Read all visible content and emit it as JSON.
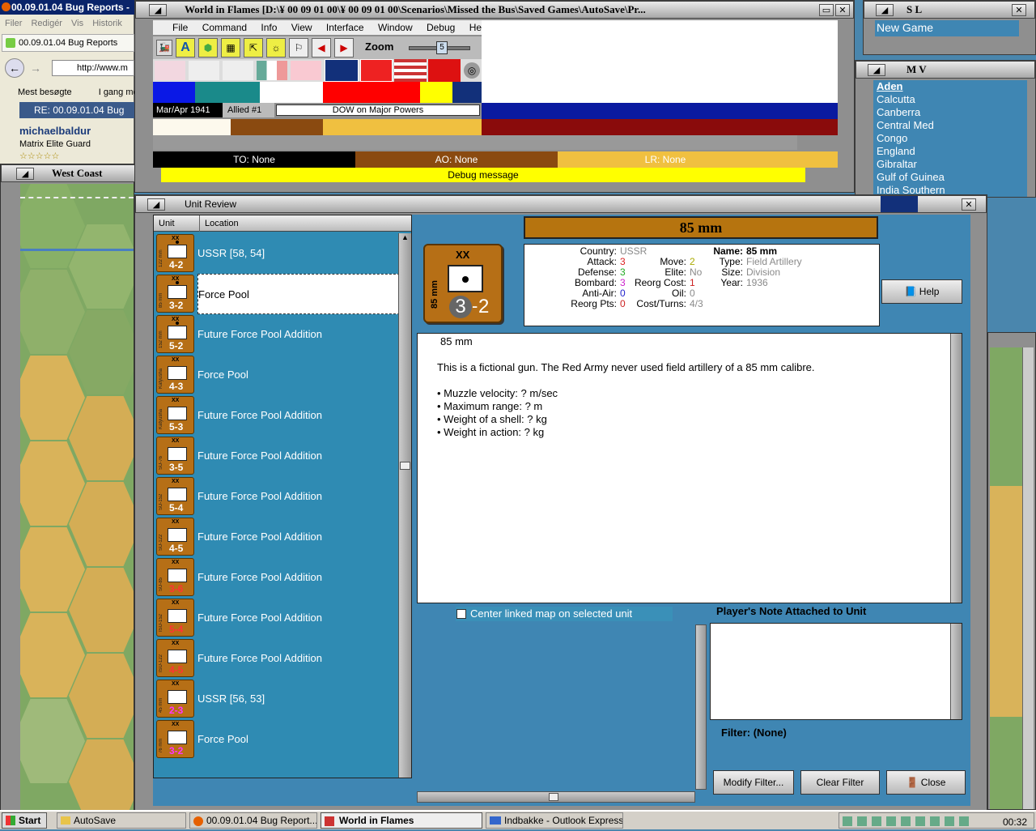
{
  "browser": {
    "title": "00.09.01.04 Bug Reports -",
    "menu": [
      "Filer",
      "Redigér",
      "Vis",
      "Historik"
    ],
    "tab": "00.09.01.04 Bug Reports",
    "url": "http://www.m",
    "bookmarks": [
      "Mest besøgte",
      "I gang me"
    ],
    "post_title": "RE: 00.09.01.04 Bug",
    "user": "michaelbaldur",
    "user_rank": "Matrix Elite Guard",
    "stars": "☆☆☆☆☆"
  },
  "westcoast": {
    "title": "West Coast"
  },
  "main": {
    "title": "World in Flames [D:\\¥ 00 09 01 00\\¥ 00 09 01 00\\Scenarios\\Missed the Bus\\Saved Games\\AutoSave\\Pr...",
    "menu": [
      "File",
      "Command",
      "Info",
      "View",
      "Interface",
      "Window",
      "Debug",
      "Help"
    ],
    "zoom_label": "Zoom",
    "zoom_value": "5",
    "date": "Mar/Apr 1941",
    "allied": "Allied #1",
    "dow": "DOW on Major Powers",
    "to": "TO: None",
    "ao": "AO: None",
    "lr": "LR: None",
    "debug": "Debug message"
  },
  "sl": {
    "title": "S L",
    "value": "New Game"
  },
  "mv": {
    "title": "M V",
    "items": [
      "Aden",
      "Calcutta",
      "Canberra",
      "Central Med",
      "Congo",
      "England",
      "Gibraltar",
      "Gulf of Guinea",
      "India Southern"
    ]
  },
  "review": {
    "title": "Unit Review",
    "col_unit": "Unit",
    "col_location": "Location",
    "rows": [
      {
        "side": "122 mm",
        "str": "4-2",
        "loc": "USSR [58, 54]"
      },
      {
        "side": "85 mm",
        "str": "3-2",
        "loc": "Force Pool"
      },
      {
        "side": "152 mm",
        "str": "5-2",
        "loc": "Future Force Pool Addition"
      },
      {
        "side": "Katyusha",
        "str": "4-3",
        "loc": "Force Pool"
      },
      {
        "side": "Katyusha",
        "str": "5-3",
        "loc": "Future Force Pool Addition"
      },
      {
        "side": "SU-76",
        "str": "3-5",
        "loc": "Future Force Pool Addition"
      },
      {
        "side": "SU-152",
        "str": "5-4",
        "loc": "Future Force Pool Addition"
      },
      {
        "side": "SU-122",
        "str": "4-5",
        "loc": "Future Force Pool Addition"
      },
      {
        "side": "SU-85",
        "str": "3-6",
        "loc": "Future Force Pool Addition"
      },
      {
        "side": "ISU-152",
        "str": "5-4",
        "loc": "Future Force Pool Addition"
      },
      {
        "side": "ISU-122",
        "str": "4-5",
        "loc": "Future Force Pool Addition"
      },
      {
        "side": "45 mm",
        "str": "2-3",
        "loc": "USSR [56, 53]"
      },
      {
        "side": "76 mm",
        "str": "3-2",
        "loc": "Force Pool"
      }
    ],
    "unit_name": "85 mm",
    "counter_xx": "XX",
    "counter_side": "85 mm",
    "counter_att": "3",
    "counter_sep": "-",
    "counter_mov": "2",
    "country_l": "Country:",
    "country": "USSR",
    "attack_l": "Attack:",
    "attack": "3",
    "defense_l": "Defense:",
    "defense": "3",
    "bombard_l": "Bombard:",
    "bombard": "3",
    "aa_l": "Anti-Air:",
    "aa": "0",
    "rp_l": "Reorg Pts:",
    "rp": "0",
    "move_l": "Move:",
    "move": "2",
    "elite_l": "Elite:",
    "elite": "No",
    "rc_l": "Reorg Cost:",
    "rc": "1",
    "oil_l": "Oil:",
    "oil": "0",
    "ct_l": "Cost/Turns:",
    "ct": "4/3",
    "name_l": "Name:",
    "name": "85 mm",
    "type_l": "Type:",
    "type": "Field Artillery",
    "size_l": "Size:",
    "size": "Division",
    "year_l": "Year:",
    "year": "1936",
    "help": "Help",
    "desc_title": "85 mm",
    "desc_body": "This is a fictional gun.  The Red Army never used field artillery of a 85 mm calibre.",
    "bullets": [
      "Muzzle velocity: ? m/sec",
      "Maximum range: ? m",
      "Weight of a shell: ? kg",
      "Weight in action: ? kg"
    ],
    "center_linked": "Center linked map on selected unit",
    "note_title": "Player's Note Attached to Unit",
    "filter": "Filter:  (None)",
    "modify": "Modify Filter...",
    "clear": "Clear Filter",
    "close": "Close"
  },
  "taskbar": {
    "start": "Start",
    "items": [
      "AutoSave",
      "00.09.01.04 Bug Report...",
      "World in Flames",
      "Indbakke - Outlook Express"
    ],
    "time": "00:32"
  },
  "colors": {
    "ocean": "#3f86b3",
    "counter": "#b66f16",
    "title_bar": "#b6740f"
  }
}
